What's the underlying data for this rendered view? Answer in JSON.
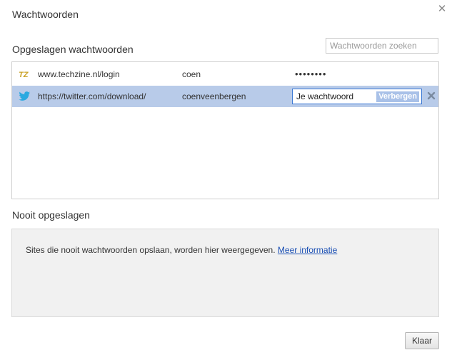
{
  "dialog": {
    "title": "Wachtwoorden",
    "close_icon": "close-icon"
  },
  "saved": {
    "heading": "Opgeslagen wachtwoorden",
    "search_placeholder": "Wachtwoorden zoeken",
    "rows": [
      {
        "favicon": "techzine-favicon",
        "url": "www.techzine.nl/login",
        "username": "coen",
        "password": "••••••••"
      },
      {
        "favicon": "twitter-favicon",
        "url": "https://twitter.com/download/",
        "username": "coenveenbergen",
        "password": "Je wachtwoord",
        "hide_label": "Verbergen",
        "delete_icon": "delete-icon"
      }
    ]
  },
  "never": {
    "heading": "Nooit opgeslagen",
    "description": "Sites die nooit wachtwoorden opslaan, worden hier weergegeven.",
    "link": "Meer informatie"
  },
  "footer": {
    "done_label": "Klaar"
  },
  "colors": {
    "selected_row": "#b8cbe9",
    "focus_border": "#3a78d4",
    "link": "#1a4fb4",
    "twitter": "#2aa9e0",
    "techzine": "#c9a227"
  }
}
